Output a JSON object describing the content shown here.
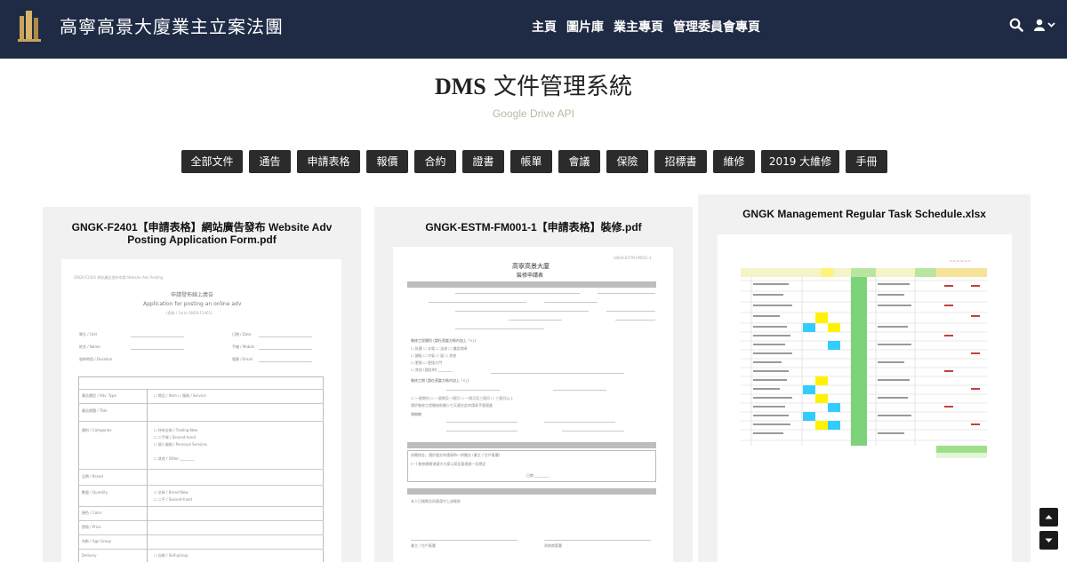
{
  "header": {
    "site_title": "高寧高景大廈業主立案法團",
    "nav": [
      {
        "label": "主頁"
      },
      {
        "label": "圖片庫"
      },
      {
        "label": "業主專頁"
      },
      {
        "label": "管理委員會專頁"
      }
    ]
  },
  "page": {
    "title_bold": "DMS",
    "title_rest": " 文件管理系統",
    "subtitle": "Google Drive API"
  },
  "categories": [
    "全部文件",
    "通告",
    "申請表格",
    "報價",
    "合約",
    "證書",
    "帳單",
    "會議",
    "保險",
    "招標書",
    "維修",
    "2019 大維修",
    "手冊"
  ],
  "documents": [
    {
      "title": "GNGK-F2401【申請表格】網站廣告發布 Website Adv Posting Application Form.pdf"
    },
    {
      "title": "GNGK-ESTM-FM001-1【申請表格】裝修.pdf"
    },
    {
      "title": "GNGK Management Regular Task Schedule.xlsx"
    }
  ],
  "doc1_preview": {
    "heading_cn": "申請發佈線上廣告",
    "heading_en": "Application for posting an online adv",
    "fields": [
      "單位 / Unit",
      "姓名 / Name",
      "發佈時段 / Duration",
      "日期 / Date",
      "手機 / Mobile",
      "電郵 / Email"
    ],
    "rows": [
      "廣告類型 / Adv. Type",
      "廣告標題 / Title",
      "類別 / Categories",
      "品牌 / Brand",
      "數量 / Quantity",
      "顏色 / Color",
      "價格 / Price",
      "年齡 / Age Group",
      "Delivery"
    ]
  },
  "doc2_preview": {
    "heading": "高寧高景大廈",
    "subheading": "裝修申請表"
  },
  "colors": {
    "header_bg": "#1f2a44",
    "button_bg": "#2b2b2b",
    "card_bg": "#f1f1f1",
    "subtitle": "#b9b9a0"
  },
  "icons": [
    "building-logo-icon",
    "search-icon",
    "user-icon",
    "chevron-down-icon",
    "arrow-up-icon",
    "arrow-down-icon"
  ]
}
